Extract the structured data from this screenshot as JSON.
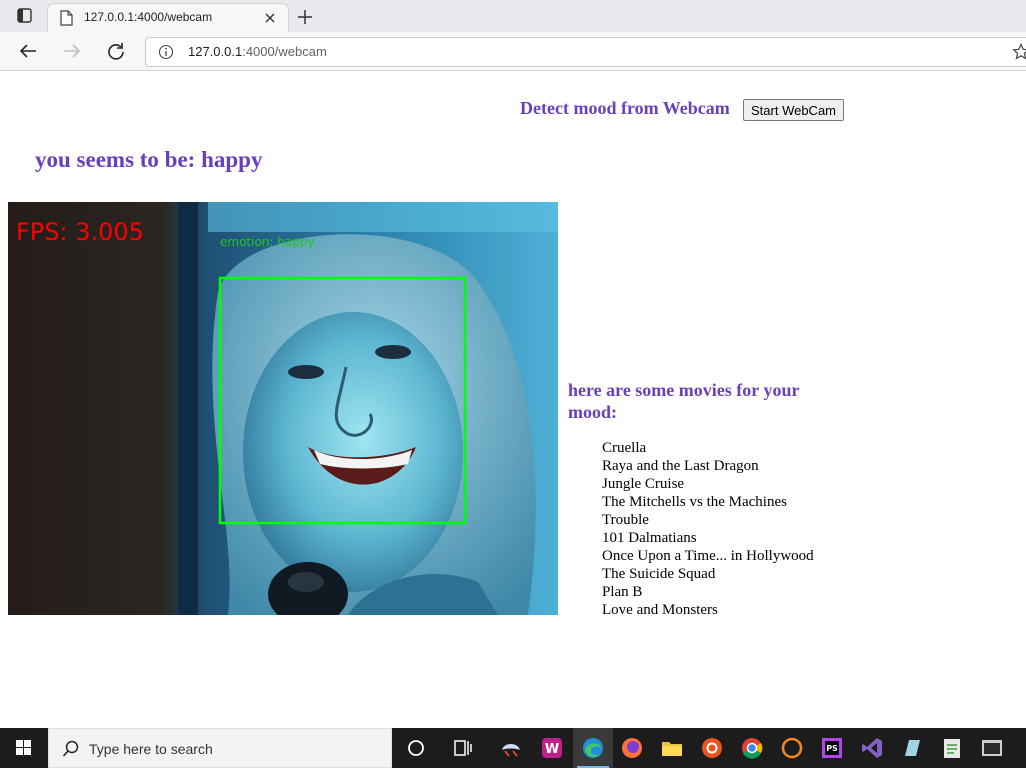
{
  "browser": {
    "tab_title": "127.0.0.1:4000/webcam",
    "url_host": "127.0.0.1",
    "url_path": ":4000/webcam"
  },
  "page": {
    "detect_heading": "Detect mood from Webcam",
    "start_button_label": "Start WebCam",
    "mood_heading": "you seems to be: happy",
    "webcam": {
      "fps_text": "FPS: 3.005",
      "emotion_text": "emotion: happy",
      "box_color": "#00ff00",
      "fps_color": "#ff0000"
    },
    "movies_heading": "here are some movies for your mood:",
    "movies": [
      "Cruella",
      "Raya and the Last Dragon",
      "Jungle Cruise",
      "The Mitchells vs the Machines",
      "Trouble",
      "101 Dalmatians",
      "Once Upon a Time... in Hollywood",
      "The Suicide Squad",
      "Plan B",
      "Love and Monsters"
    ]
  },
  "taskbar": {
    "search_placeholder": "Type here to search",
    "apps": [
      "task-view",
      "widgets",
      "game-app",
      "winamp-app",
      "edge",
      "firefox",
      "file-explorer",
      "ubuntu",
      "chrome",
      "eclipse",
      "phpstorm",
      "visual-studio",
      "app-generic-1",
      "app-generic-2",
      "app-generic-3"
    ]
  },
  "colors": {
    "heading_purple": "#6a3fbd",
    "taskbar_bg": "#1c1c1c"
  }
}
